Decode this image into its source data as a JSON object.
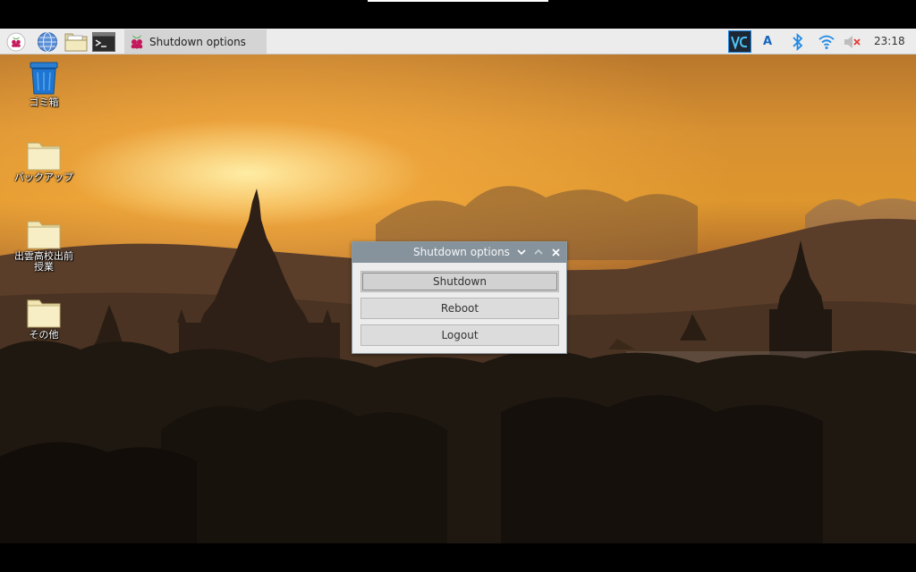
{
  "taskbar": {
    "launchers": [
      {
        "name": "raspberry-menu-icon"
      },
      {
        "name": "web-browser-icon"
      },
      {
        "name": "file-manager-icon"
      },
      {
        "name": "terminal-icon"
      }
    ],
    "task_label": "Shutdown options",
    "tray": {
      "vnc_icon": "VNC",
      "keyboard_layout": "A",
      "clock": "23:18"
    }
  },
  "desktop": {
    "icons": [
      {
        "label": "ゴミ箱",
        "icon": "trash-icon"
      },
      {
        "label": "バックアップ",
        "icon": "folder-icon"
      },
      {
        "label": "出雲高校出前\n授業",
        "icon": "folder-icon"
      },
      {
        "label": "その他",
        "icon": "folder-icon"
      }
    ]
  },
  "dialog": {
    "title": "Shutdown options",
    "buttons": {
      "shutdown": "Shutdown",
      "reboot": "Reboot",
      "logout": "Logout"
    }
  },
  "colors": {
    "taskbar_bg": "#ececec",
    "titlebar_bg": "#87939c",
    "vnc_accent": "#1e88e5"
  }
}
